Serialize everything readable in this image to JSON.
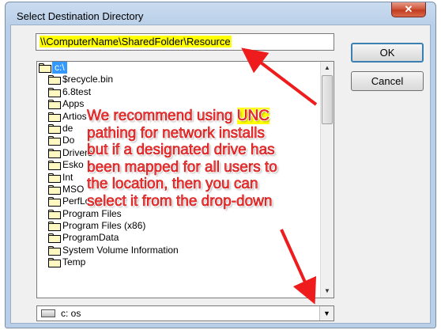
{
  "dialog": {
    "title": "Select Destination Directory",
    "close_glyph": "✕",
    "close_icon": "close-icon"
  },
  "path_input": {
    "value": "\\\\ComputerName\\SharedFolder\\Resource"
  },
  "buttons": {
    "ok": "OK",
    "cancel": "Cancel"
  },
  "folder_list": {
    "root": "c:\\",
    "items": [
      "$recycle.bin",
      "6.8test",
      "Apps",
      "Artios",
      "de",
      "Do",
      "Drivers",
      "Esko",
      "Int",
      "MSO",
      "PerfLogs",
      "Program Files",
      "Program Files (x86)",
      "ProgramData",
      "System Volume Information",
      "Temp"
    ]
  },
  "drive_combo": {
    "selected": "c:  os"
  },
  "annotation": {
    "line1_pre": "We recommend using ",
    "line1_hl": "UNC",
    "line2": "pathing for network installs",
    "line3": "but if a designated drive has",
    "line4": "been mapped for all users to",
    "line5": "the location, then you can",
    "line6": "select it from the drop-down"
  },
  "colors": {
    "annotation_text": "#ff3a3a",
    "highlight": "#ffff00",
    "arrow": "#ee1c1c",
    "selection": "#3399ff"
  }
}
